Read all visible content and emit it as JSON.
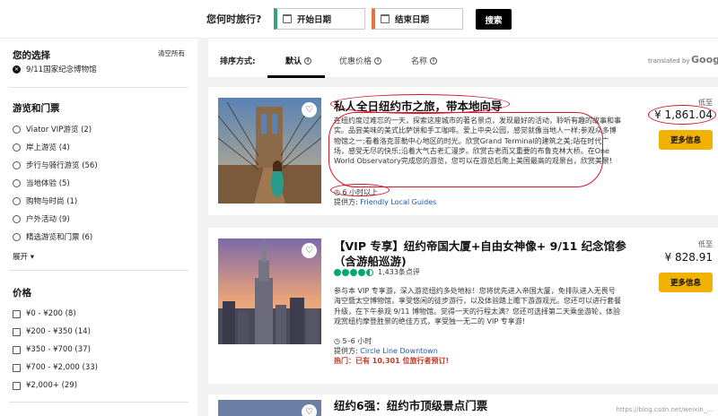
{
  "search": {
    "prompt": "您何时旅行?",
    "start_date": "开始日期",
    "end_date": "结束日期",
    "button": "搜索"
  },
  "sidebar": {
    "selection_title": "您的选择",
    "clear_all": "清空所有",
    "selected_filter": "9/11国家纪念博物馆",
    "tours_title": "游览和门票",
    "tour_options": [
      "Viator VIP游览 (2)",
      "岸上游览 (4)",
      "步行与骑行游览 (56)",
      "当地体验 (5)",
      "购物与时尚 (1)",
      "户外活动 (9)",
      "精选游览和门票 (6)"
    ],
    "expand_label": "展开",
    "price_title": "价格",
    "price_options": [
      "¥0 - ¥200 (8)",
      "¥200 - ¥350 (14)",
      "¥350 - ¥700 (37)",
      "¥700 - ¥2,000 (33)",
      "¥2,000+ (29)"
    ]
  },
  "sortbar": {
    "label": "排序方式:",
    "tabs": [
      "默认",
      "优惠价格",
      "名称"
    ],
    "translated_by": "translated by",
    "google": "Google"
  },
  "cards": [
    {
      "title": "私人全日纽约市之旅，带本地向导",
      "description": "在纽约度过难忘的一天，探索这座城市的著名景点，发现最好的活动，聆听有趣的故事和事实。品尝美味的美式比萨饼和手工咖啡。爱上中央公园，感觉就像当地人一样;参观众多博物馆之一;看着洛克菲勒中心地区的时光。欣赏Grand Terminal的建筑之美;站在时代广场，感受无尽的快乐;沿着大气古老汇漫步。欣赏古老而又重要的布鲁克林大桥。在One World Observatory完成您的游览，您可以在游览后爬上美国最高的观景台，欣赏美景!",
      "duration": "6 小时以上",
      "provider_label": "提供方:",
      "provider": "Friendly Local Guides",
      "from_label": "低至",
      "price": "¥ 1,861.04",
      "button": "更多信息"
    },
    {
      "title": "【VIP 专享】纽约帝国大厦+自由女神像+ 9/11 纪念馆参（含游船巡游)",
      "rating": 4.5,
      "reviews": "1,433条点评",
      "description": "参与本 VIP 专享游，深入游览纽约多处地标！您将优先进入帝国大厦，免排队进入无畏号海空暨太空博物馆，享受悠闲的徒步游行，以及体验踏上瞻下游游观光。您还可以进行套餐升级，在下午参观 9/11 博物馆。觉得一天的行程太满？您还可选择第二天乘坐游轮，体验观赏纽约摩登胜景的绝佳方式，享受独一无二的 VIP 专享游!",
      "duration": "5–6 小时",
      "provider_label": "提供方:",
      "provider": "Circle Line Downtown",
      "hot": "热门：已有 10,301 位旅行者预订!",
      "from_label": "低至",
      "price": "¥ 828.91",
      "button": "更多信息"
    },
    {
      "title": "纽约6强：纽约市顶级景点门票",
      "watermark": "https://blog.csdn.net/weixin_..."
    }
  ],
  "colors": {
    "accent": "#f2b203",
    "rating": "#00aa6c",
    "link": "#1a5aa8",
    "annotation": "#d9152a"
  }
}
